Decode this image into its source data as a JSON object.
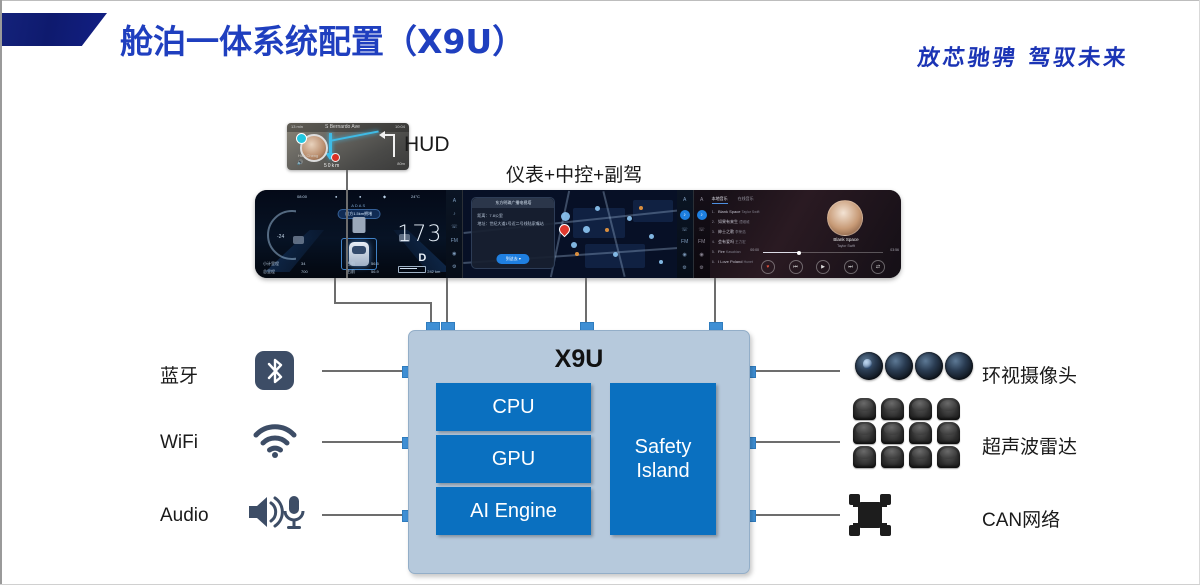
{
  "header": {
    "title": "舱泊一体系统配置（X9U）",
    "tagline": "放芯驰骋  驾驭未来",
    "banner_color": "#121f84",
    "title_color": "#1f3fbf"
  },
  "labels": {
    "hud": "HUD",
    "cluster_group": "仪表+中控+副驾"
  },
  "hud_screen": {
    "street": "S Bernardo Ave",
    "eta": "10:04",
    "left_time": "13 min",
    "speed": "50",
    "speed_unit": "km",
    "driver_name": "Han Cheng",
    "mic_text": "Voice",
    "distance": "80m"
  },
  "cluster_screen": {
    "clock": "08:00",
    "temperature": "24°C",
    "adas": "ADAS",
    "notice": "前方1.5km拥堵",
    "speed": "173",
    "speed_unit": "km/h",
    "gear": "D",
    "range": "242 km",
    "gauge_value": "-24",
    "gauge_unit": "km",
    "foot": [
      {
        "label": "小计里程",
        "value": "34",
        "unit": "km"
      },
      {
        "label": "总里程",
        "value": "700",
        "unit": "km"
      },
      {
        "label": "左前",
        "value": "56.5",
        "unit": "℃"
      },
      {
        "label": "右前",
        "value": "56.9",
        "unit": "℃"
      }
    ],
    "rail": [
      "A",
      "♪",
      "☏",
      "FM",
      "◉",
      "⚙"
    ]
  },
  "map_screen": {
    "card_title": "东方明珠广播电视塔",
    "card_line1": "距离：7.8公里",
    "card_line2": "地址：世纪大道1号近二号线陆家嘴站",
    "card_button": "到这去 ▾",
    "rail": [
      "A",
      "♪",
      "☏",
      "FM",
      "◉",
      "⚙"
    ]
  },
  "music_screen": {
    "tabs": [
      "本地音乐",
      "在线音乐"
    ],
    "active_tab": "本地音乐",
    "tracks": [
      {
        "index": "1.",
        "title": "Blank Space",
        "artist": "Taylor Swift"
      },
      {
        "index": "2.",
        "title": "如果有来生",
        "artist": "谭维维"
      },
      {
        "index": "3.",
        "title": "绅士之歌",
        "artist": "李荣浩"
      },
      {
        "index": "4.",
        "title": "会有爱吗",
        "artist": "王力宏"
      },
      {
        "index": "5.",
        "title": "Fire",
        "artist": "Kasabian"
      },
      {
        "index": "6.",
        "title": "I Love Poland",
        "artist": "Hunet"
      }
    ],
    "now_title": "Blank Space",
    "now_artist": "Taylor Swift",
    "elapsed": "00:00",
    "duration": "03:56",
    "controls": [
      "♥",
      "⏮",
      "▶",
      "⏭",
      "⇄"
    ],
    "rail": [
      "A",
      "♪",
      "☏",
      "FM",
      "◉",
      "⚙"
    ]
  },
  "chip": {
    "title": "X9U",
    "body_color": "#b6c9dc",
    "block_color": "#0a70c0",
    "pin_color": "#3f8fd4",
    "blocks": [
      {
        "label": "CPU"
      },
      {
        "label": "GPU"
      },
      {
        "label": "AI Engine"
      },
      {
        "label": "Safety\nIsland",
        "line1": "Safety",
        "line2": "Island"
      }
    ]
  },
  "left_io": [
    {
      "label": "蓝牙",
      "icon": "bluetooth-icon"
    },
    {
      "label": "WiFi",
      "icon": "wifi-icon"
    },
    {
      "label": "Audio",
      "icon": "audio-icon"
    }
  ],
  "right_io": [
    {
      "label": "环视摄像头",
      "icon": "surround-camera-icon",
      "count": 4
    },
    {
      "label": "超声波雷达",
      "icon": "ultrasonic-sensor-icon",
      "count": 12
    },
    {
      "label": "CAN网络",
      "icon": "can-network-icon",
      "count": 1
    }
  ]
}
